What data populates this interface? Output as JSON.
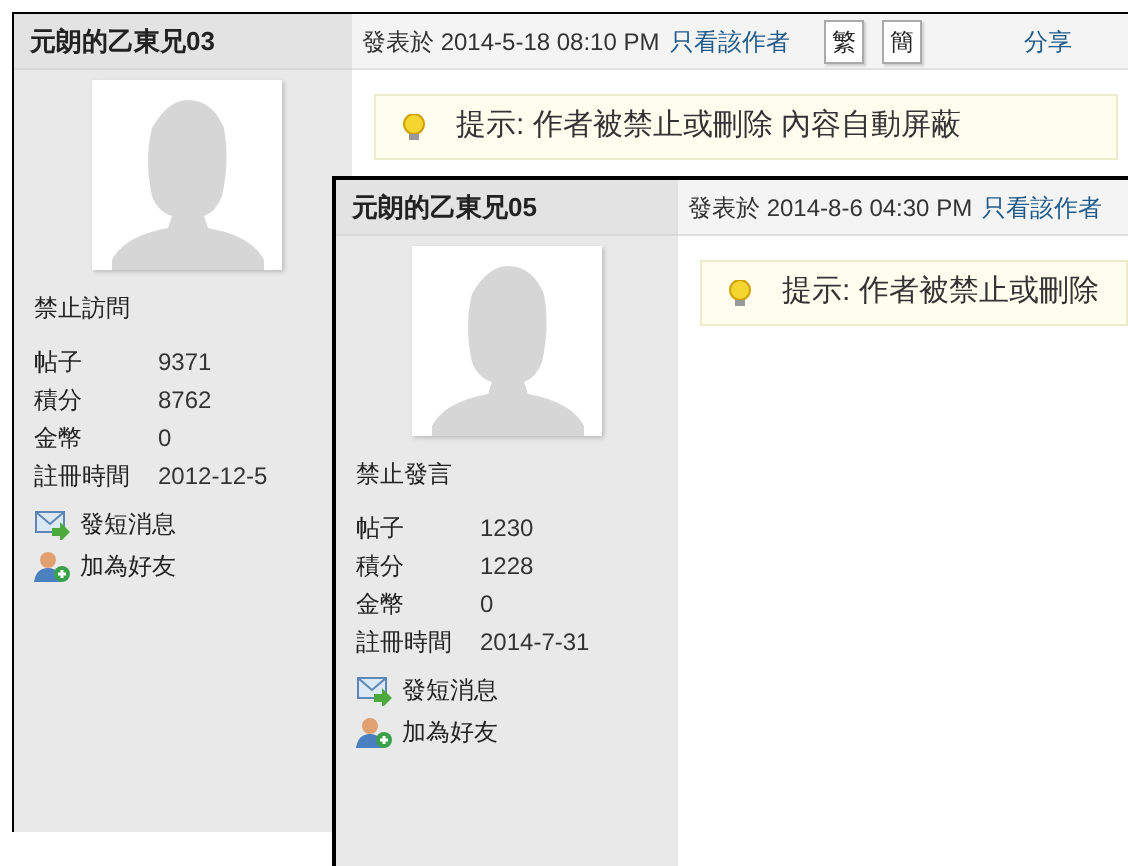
{
  "posts": [
    {
      "author": "元朗的乙東兄03",
      "posted": "發表於 2014-5-18 08:10 PM",
      "author_only_link": "只看該作者",
      "buttons": [
        "繁",
        "簡"
      ],
      "share": "分享",
      "notice": "提示: 作者被禁止或刪除 內容自動屏蔽",
      "status": "禁止訪問",
      "stats": [
        {
          "label": "帖子",
          "value": "9371"
        },
        {
          "label": "積分",
          "value": "8762"
        },
        {
          "label": "金幣",
          "value": "0"
        },
        {
          "label": "註冊時間",
          "value": "2012-12-5"
        }
      ],
      "actions": [
        {
          "kind": "message",
          "label": "發短消息"
        },
        {
          "kind": "add-friend",
          "label": "加為好友"
        }
      ]
    },
    {
      "author": "元朗的乙東兄05",
      "posted": "發表於 2014-8-6 04:30 PM",
      "author_only_link": "只看該作者",
      "notice": "提示: 作者被禁止或刪除",
      "status": "禁止發言",
      "stats": [
        {
          "label": "帖子",
          "value": "1230"
        },
        {
          "label": "積分",
          "value": "1228"
        },
        {
          "label": "金幣",
          "value": "0"
        },
        {
          "label": "註冊時間",
          "value": "2014-7-31"
        }
      ],
      "actions": [
        {
          "kind": "message",
          "label": "發短消息"
        },
        {
          "kind": "add-friend",
          "label": "加為好友"
        }
      ]
    }
  ]
}
